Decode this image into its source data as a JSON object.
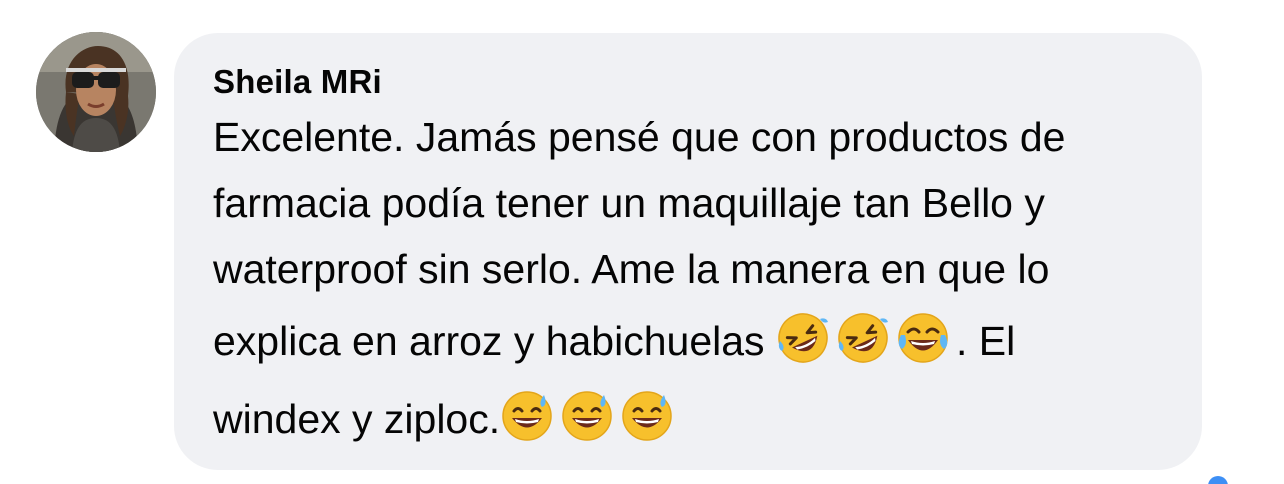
{
  "comment": {
    "author": "Sheila MRi",
    "lines": [
      "Excelente. Jamás pensé que con productos de",
      "farmacia podía tener un maquillaje tan Bello y",
      "waterproof sin serlo. Ame la manera en que lo",
      "explica en arroz y habichuelas",
      ". El",
      "windex y ziploc."
    ],
    "emojis_line4": [
      "rolling-on-floor-laughing",
      "rolling-on-floor-laughing",
      "face-with-tears-of-joy"
    ],
    "emojis_line5": [
      "grinning-face-with-sweat",
      "grinning-face-with-sweat",
      "grinning-face-with-sweat"
    ]
  },
  "colors": {
    "bubble": "#f0f1f4",
    "text": "#050505",
    "emoji_yellow": "#f7c02c"
  }
}
